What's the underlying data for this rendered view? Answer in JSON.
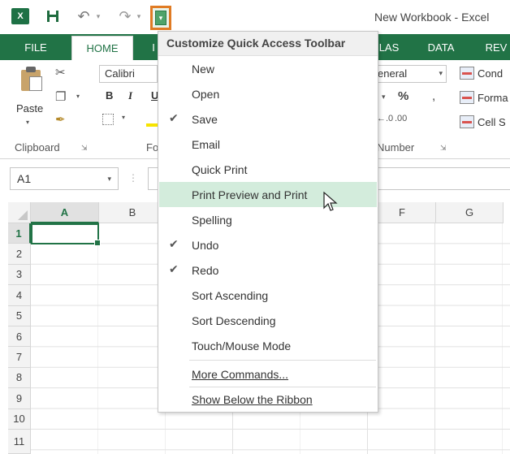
{
  "window": {
    "title": "New Workbook - Excel",
    "app_logo_text": "X┃"
  },
  "quick_access_toolbar": {
    "save_icon": "floppy-disk-icon",
    "undo_icon": "undo-icon",
    "redo_icon": "redo-icon",
    "customize_icon": "customize-qat-icon",
    "customize_highlight_color": "#e07b24"
  },
  "ribbon_tabs": {
    "file": "FILE",
    "home": "HOME",
    "insert_partial": "I",
    "formulas_partial": "LAS",
    "data": "DATA",
    "review_partial": "REV"
  },
  "ribbon": {
    "clipboard": {
      "paste_label": "Paste",
      "group_label": "Clipboard"
    },
    "font": {
      "font_name": "Calibri",
      "bold": "B",
      "italic": "I",
      "underline": "U",
      "group_label_partial": "Fo"
    },
    "number": {
      "format_partial": "eneral",
      "percent": "%",
      "comma": ",",
      "increase_decimal": "←.0",
      "decrease_decimal": ".00",
      "group_label_partial": "Number"
    },
    "styles": {
      "conditional_partial": "Cond",
      "format_partial": "Forma",
      "cell_partial": "Cell S"
    }
  },
  "formula_bar": {
    "name_box_value": "A1",
    "separator": "⋮"
  },
  "sheet": {
    "columns": [
      "A",
      "B",
      "F",
      "G"
    ],
    "rows": [
      "1",
      "2",
      "3",
      "4",
      "5",
      "6",
      "7",
      "8",
      "9",
      "10",
      "11"
    ],
    "active_cell": "A1",
    "accent_color": "#217346"
  },
  "customize_menu": {
    "title": "Customize Quick Access Toolbar",
    "items": [
      {
        "label": "New",
        "checked": false
      },
      {
        "label": "Open",
        "checked": false
      },
      {
        "label": "Save",
        "checked": true
      },
      {
        "label": "Email",
        "checked": false
      },
      {
        "label": "Quick Print",
        "checked": false
      },
      {
        "label": "Print Preview and Print",
        "checked": false,
        "hovered": true
      },
      {
        "label": "Spelling",
        "checked": false
      },
      {
        "label": "Undo",
        "checked": true
      },
      {
        "label": "Redo",
        "checked": true
      },
      {
        "label": "Sort Ascending",
        "checked": false
      },
      {
        "label": "Sort Descending",
        "checked": false
      },
      {
        "label": "Touch/Mouse Mode",
        "checked": false
      }
    ],
    "more_commands": "More Commands...",
    "show_below": "Show Below the Ribbon",
    "check_glyph": "✔",
    "hover_color": "#d3ecdc"
  }
}
